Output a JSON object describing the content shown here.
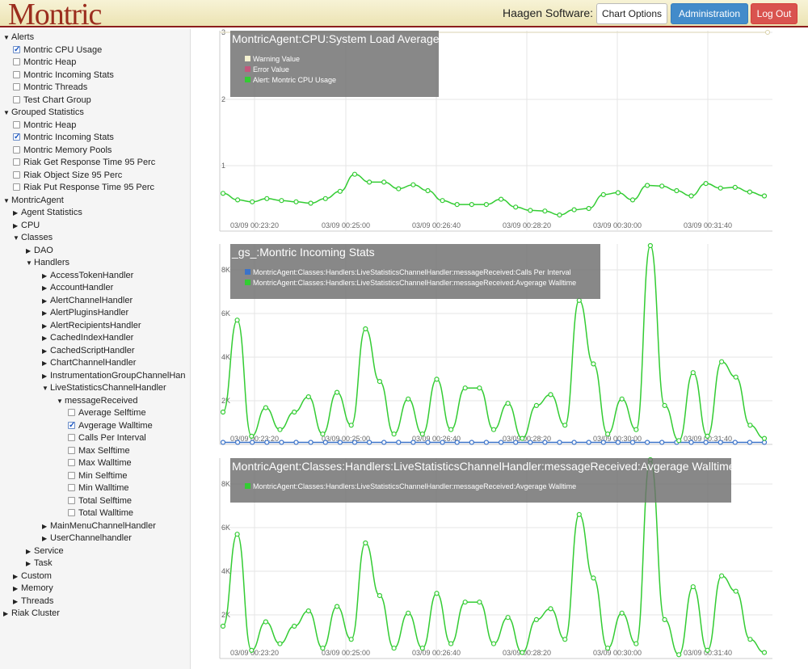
{
  "header": {
    "logo": "Montric",
    "company": "Haagen Software:",
    "buttons": {
      "chart_options": "Chart Options",
      "administration": "Administration",
      "logout": "Log Out"
    }
  },
  "tree": [
    {
      "label": "Alerts",
      "depth": 0,
      "kind": "open"
    },
    {
      "label": "Montric CPU Usage",
      "depth": 1,
      "kind": "check",
      "checked": true
    },
    {
      "label": "Montric Heap",
      "depth": 1,
      "kind": "check",
      "checked": false
    },
    {
      "label": "Montric Incoming Stats",
      "depth": 1,
      "kind": "check",
      "checked": false
    },
    {
      "label": "Montric Threads",
      "depth": 1,
      "kind": "check",
      "checked": false
    },
    {
      "label": "Test Chart Group",
      "depth": 1,
      "kind": "check",
      "checked": false
    },
    {
      "label": "Grouped Statistics",
      "depth": 0,
      "kind": "open"
    },
    {
      "label": "Montric Heap",
      "depth": 1,
      "kind": "check",
      "checked": false
    },
    {
      "label": "Montric Incoming Stats",
      "depth": 1,
      "kind": "check",
      "checked": true
    },
    {
      "label": "Montric Memory Pools",
      "depth": 1,
      "kind": "check",
      "checked": false
    },
    {
      "label": "Riak Get Response Time 95 Perc",
      "depth": 1,
      "kind": "check",
      "checked": false
    },
    {
      "label": "Riak Object Size 95 Perc",
      "depth": 1,
      "kind": "check",
      "checked": false
    },
    {
      "label": "Riak Put Response Time 95 Perc",
      "depth": 1,
      "kind": "check",
      "checked": false
    },
    {
      "label": "MontricAgent",
      "depth": 0,
      "kind": "open"
    },
    {
      "label": "Agent Statistics",
      "depth": 1,
      "kind": "closed"
    },
    {
      "label": "CPU",
      "depth": 1,
      "kind": "closed"
    },
    {
      "label": "Classes",
      "depth": 1,
      "kind": "open"
    },
    {
      "label": "DAO",
      "depth": 2,
      "kind": "closed"
    },
    {
      "label": "Handlers",
      "depth": 2,
      "kind": "open"
    },
    {
      "label": "AccessTokenHandler",
      "depth": 3,
      "kind": "closed"
    },
    {
      "label": "AccountHandler",
      "depth": 3,
      "kind": "closed"
    },
    {
      "label": "AlertChannelHandler",
      "depth": 3,
      "kind": "closed"
    },
    {
      "label": "AlertPluginsHandler",
      "depth": 3,
      "kind": "closed"
    },
    {
      "label": "AlertRecipientsHandler",
      "depth": 3,
      "kind": "closed"
    },
    {
      "label": "CachedIndexHandler",
      "depth": 3,
      "kind": "closed"
    },
    {
      "label": "CachedScriptHandler",
      "depth": 3,
      "kind": "closed"
    },
    {
      "label": "ChartChannelHandler",
      "depth": 3,
      "kind": "closed"
    },
    {
      "label": "InstrumentationGroupChannelHan",
      "depth": 3,
      "kind": "closed"
    },
    {
      "label": "LiveStatisticsChannelHandler",
      "depth": 3,
      "kind": "open"
    },
    {
      "label": "messageReceived",
      "depth": 4,
      "kind": "open"
    },
    {
      "label": "Average Selftime",
      "depth": 5,
      "kind": "check",
      "checked": false
    },
    {
      "label": "Avgerage Walltime",
      "depth": 5,
      "kind": "check",
      "checked": true
    },
    {
      "label": "Calls Per Interval",
      "depth": 5,
      "kind": "check",
      "checked": false
    },
    {
      "label": "Max Selftime",
      "depth": 5,
      "kind": "check",
      "checked": false
    },
    {
      "label": "Max Walltime",
      "depth": 5,
      "kind": "check",
      "checked": false
    },
    {
      "label": "Min Selftime",
      "depth": 5,
      "kind": "check",
      "checked": false
    },
    {
      "label": "Min Walltime",
      "depth": 5,
      "kind": "check",
      "checked": false
    },
    {
      "label": "Total Selftime",
      "depth": 5,
      "kind": "check",
      "checked": false
    },
    {
      "label": "Total Walltime",
      "depth": 5,
      "kind": "check",
      "checked": false
    },
    {
      "label": "MainMenuChannelHandler",
      "depth": 3,
      "kind": "closed"
    },
    {
      "label": "UserChannelhandler",
      "depth": 3,
      "kind": "closed"
    },
    {
      "label": "Service",
      "depth": 2,
      "kind": "closed"
    },
    {
      "label": "Task",
      "depth": 2,
      "kind": "closed"
    },
    {
      "label": "Custom",
      "depth": 1,
      "kind": "closed"
    },
    {
      "label": "Memory",
      "depth": 1,
      "kind": "closed"
    },
    {
      "label": "Threads",
      "depth": 1,
      "kind": "closed"
    },
    {
      "label": "Riak Cluster",
      "depth": 0,
      "kind": "closed"
    }
  ],
  "colors": {
    "green": "#33cc33",
    "blue": "#3b73c9",
    "warning": "#f4f1d0",
    "error": "#c2587c",
    "grid": "#e6e6e6"
  },
  "chart_data": [
    {
      "type": "line",
      "title": "MontricAgent:CPU:System Load Average",
      "x_ticks": [
        "03/09 00:23:20",
        "03/09 00:25:00",
        "03/09 00:26:40",
        "03/09 00:28:20",
        "03/09 00:30:00",
        "03/09 00:31:40"
      ],
      "y_ticks": [
        "1",
        "2",
        "3"
      ],
      "ylim": [
        0,
        3
      ],
      "series": [
        {
          "name": "Warning Value",
          "color": "#f4f1d0",
          "values": [
            3,
            3
          ]
        },
        {
          "name": "Error Value",
          "color": "#c2587c",
          "values": []
        },
        {
          "name": "Alert: Montric CPU Usage",
          "color": "#33cc33",
          "values": [
            0.55,
            0.45,
            0.42,
            0.47,
            0.44,
            0.42,
            0.4,
            0.47,
            0.58,
            0.84,
            0.72,
            0.72,
            0.62,
            0.68,
            0.59,
            0.44,
            0.38,
            0.38,
            0.38,
            0.46,
            0.34,
            0.29,
            0.28,
            0.22,
            0.3,
            0.32,
            0.53,
            0.56,
            0.45,
            0.67,
            0.66,
            0.59,
            0.51,
            0.7,
            0.63,
            0.64,
            0.57,
            0.51
          ]
        }
      ]
    },
    {
      "type": "line",
      "title": "_gs_:Montric Incoming Stats",
      "x_ticks": [
        "03/09 00:23:20",
        "03/09 00:25:00",
        "03/09 00:26:40",
        "03/09 00:28:20",
        "03/09 00:30:00",
        "03/09 00:31:40"
      ],
      "y_ticks": [
        "2K",
        "4K",
        "6K",
        "8K"
      ],
      "ylim": [
        0,
        9000
      ],
      "series": [
        {
          "name": "MontricAgent:Classes:Handlers:LiveStatisticsChannelHandler:messageReceived:Calls Per Interval",
          "color": "#3b73c9",
          "values": [
            20,
            20,
            20,
            20,
            20,
            20,
            20,
            20,
            20,
            20,
            20,
            20,
            20,
            20,
            20,
            20,
            20,
            20,
            20,
            20,
            20,
            20,
            20,
            20,
            20,
            20,
            20,
            20,
            20,
            20,
            20,
            20,
            20,
            20,
            20,
            20,
            20,
            20
          ]
        },
        {
          "name": "MontricAgent:Classes:Handlers:LiveStatisticsChannelHandler:messageReceived:Avgerage Walltime",
          "color": "#33cc33",
          "values": [
            1400,
            5600,
            300,
            1600,
            600,
            1400,
            2100,
            400,
            2300,
            800,
            5200,
            2800,
            400,
            2000,
            400,
            2900,
            600,
            2500,
            2500,
            600,
            1800,
            200,
            1700,
            2200,
            800,
            6500,
            3600,
            400,
            2000,
            600,
            9000,
            1700,
            100,
            3200,
            300,
            3700,
            3000,
            800,
            200
          ]
        }
      ]
    },
    {
      "type": "line",
      "title": "MontricAgent:Classes:Handlers:LiveStatisticsChannelHandler:messageReceived:Avgerage Walltime",
      "x_ticks": [
        "03/09 00:23:20",
        "03/09 00:25:00",
        "03/09 00:26:40",
        "03/09 00:28:20",
        "03/09 00:30:00",
        "03/09 00:31:40"
      ],
      "y_ticks": [
        "2K",
        "4K",
        "6K",
        "8K"
      ],
      "ylim": [
        0,
        9000
      ],
      "series": [
        {
          "name": "MontricAgent:Classes:Handlers:LiveStatisticsChannelHandler:messageReceived:Avgerage Walltime",
          "color": "#33cc33",
          "values": [
            1400,
            5600,
            300,
            1600,
            600,
            1400,
            2100,
            400,
            2300,
            800,
            5200,
            2800,
            400,
            2000,
            400,
            2900,
            600,
            2500,
            2500,
            600,
            1800,
            200,
            1700,
            2200,
            800,
            6500,
            3600,
            400,
            2000,
            600,
            9000,
            1700,
            100,
            3200,
            300,
            3700,
            3000,
            800,
            200
          ]
        }
      ]
    }
  ]
}
